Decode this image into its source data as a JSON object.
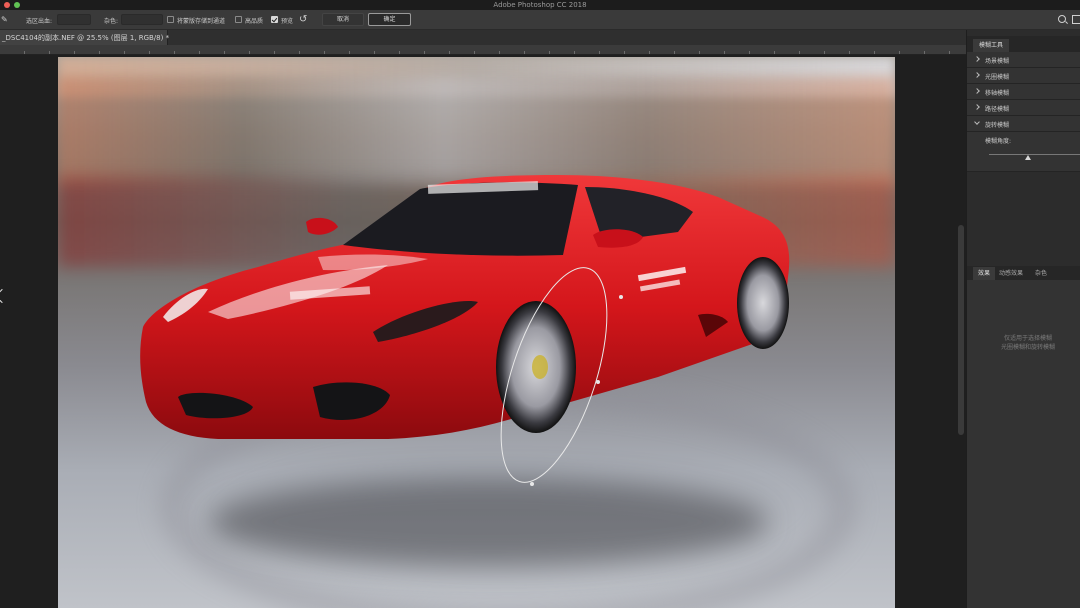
{
  "app": {
    "title": "Adobe Photoshop CC 2018"
  },
  "options_bar": {
    "selection_label": "选区出血:",
    "noise_label": "杂色:",
    "save_mask_label": "将蒙版存储到通道",
    "high_quality_label": "高品质",
    "preview_label": "预览",
    "cancel_label": "取消",
    "ok_label": "确定",
    "save_mask_checked": false,
    "high_quality_checked": false,
    "preview_checked": true
  },
  "document": {
    "tab_label": "_DSC4104的副本.NEF @ 25.5% (图层 1, RGB/8) *"
  },
  "blur_panel": {
    "tab_label": "模糊工具",
    "items": [
      {
        "label": "场景模糊",
        "open": false
      },
      {
        "label": "光圈模糊",
        "open": false
      },
      {
        "label": "移轴模糊",
        "open": false
      },
      {
        "label": "路径模糊",
        "open": false
      },
      {
        "label": "旋转模糊",
        "open": true
      }
    ],
    "angle_label": "模糊角度:",
    "angle_fraction": 0.42
  },
  "effects_panel": {
    "tabs": [
      "效果",
      "动感效果",
      "杂色"
    ],
    "note": "仅适用于选择模糊\n光圈模糊和旋转模糊"
  },
  "colors": {
    "car_red": "#d4161b",
    "ui_bg": "#262626",
    "panel_bg": "#333333"
  }
}
